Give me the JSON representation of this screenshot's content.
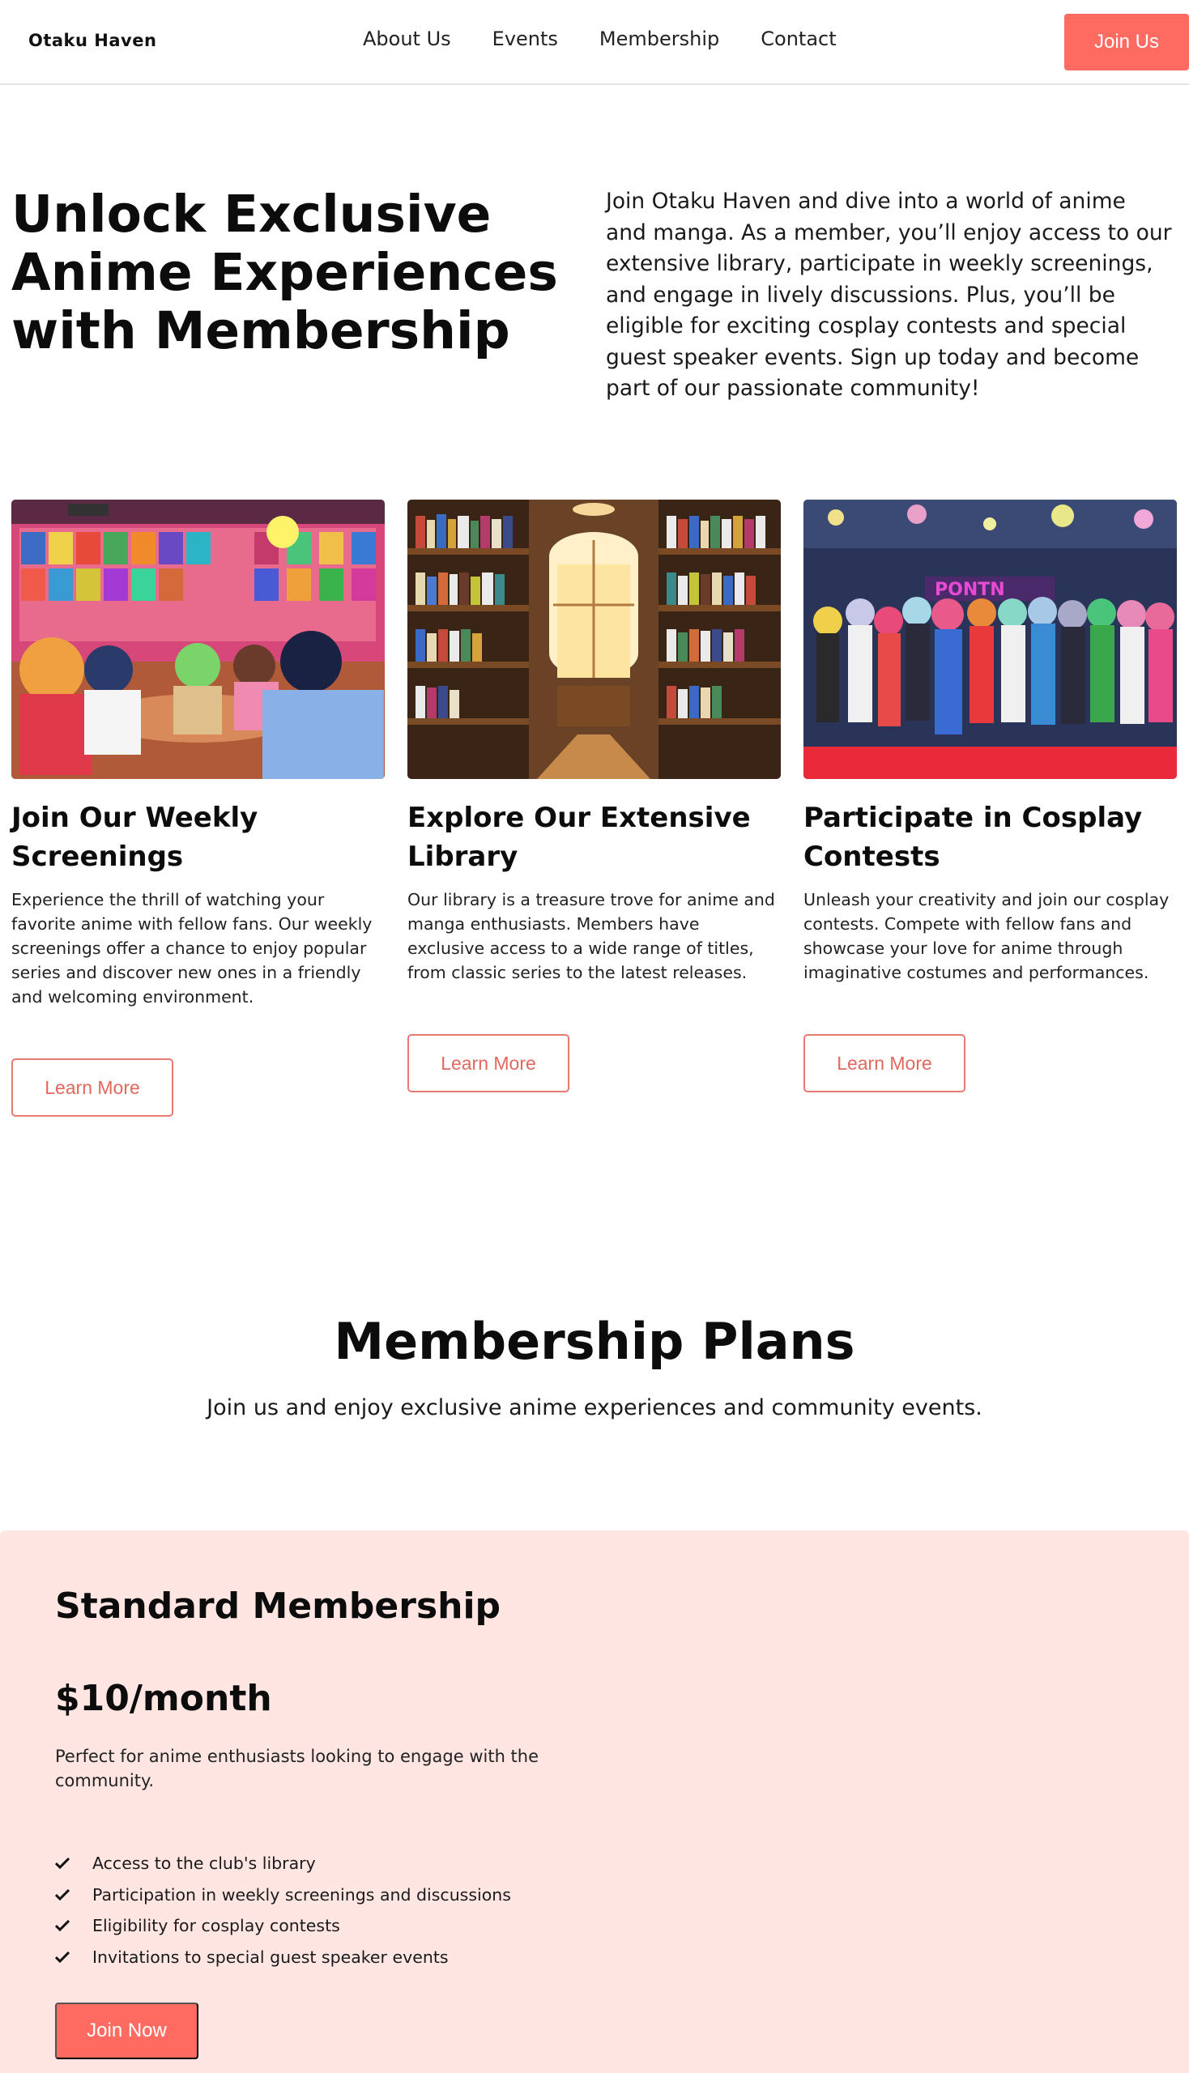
{
  "nav": {
    "logo": "Otaku Haven",
    "links": [
      "About Us",
      "Events",
      "Membership",
      "Contact"
    ],
    "cta": "Join Us"
  },
  "hero": {
    "title": "Unlock Exclusive Anime Experiences with Membership",
    "text": "Join Otaku Haven and dive into a world of anime and manga. As a member, you’ll enjoy access to our extensive library, participate in weekly screenings, and engage in lively discussions. Plus, you’ll be eligible for exciting cosplay contests and special guest speaker events. Sign up today and become part of our passionate community!"
  },
  "features": [
    {
      "image": "anime-screening-room-image",
      "title": "Join Our Weekly Screenings",
      "text": "Experience the thrill of watching your favorite anime with fellow fans. Our weekly screenings offer a chance to enjoy popular series and discover new ones in a friendly and welcoming environment.",
      "button": "Learn More"
    },
    {
      "image": "library-bookshelves-image",
      "title": "Explore Our Extensive Library",
      "text": "Our library is a treasure trove for anime and manga enthusiasts. Members have exclusive access to a wide range of titles, from classic series to the latest releases.",
      "button": "Learn More"
    },
    {
      "image": "cosplay-group-image",
      "title": "Participate in Cosplay Contests",
      "text": "Unleash your creativity and join our cosplay contests. Compete with fellow fans and showcase your love for anime through imaginative costumes and performances.",
      "button": "Learn More"
    }
  ],
  "plans": {
    "title": "Membership Plans",
    "subtitle": "Join us and enjoy exclusive anime experiences and community events.",
    "plan": {
      "name": "Standard Membership",
      "price": "$10/month",
      "description": "Perfect for anime enthusiasts looking to engage with the community.",
      "features": [
        "Access to the club's library",
        "Participation in weekly screenings and discussions",
        "Eligibility for cosplay contests",
        "Invitations to special guest speaker events"
      ],
      "button": "Join Now"
    }
  },
  "colors": {
    "accent": "#ff6b61",
    "plan_bg": "#ffe6e3",
    "outline": "#e87a72"
  }
}
